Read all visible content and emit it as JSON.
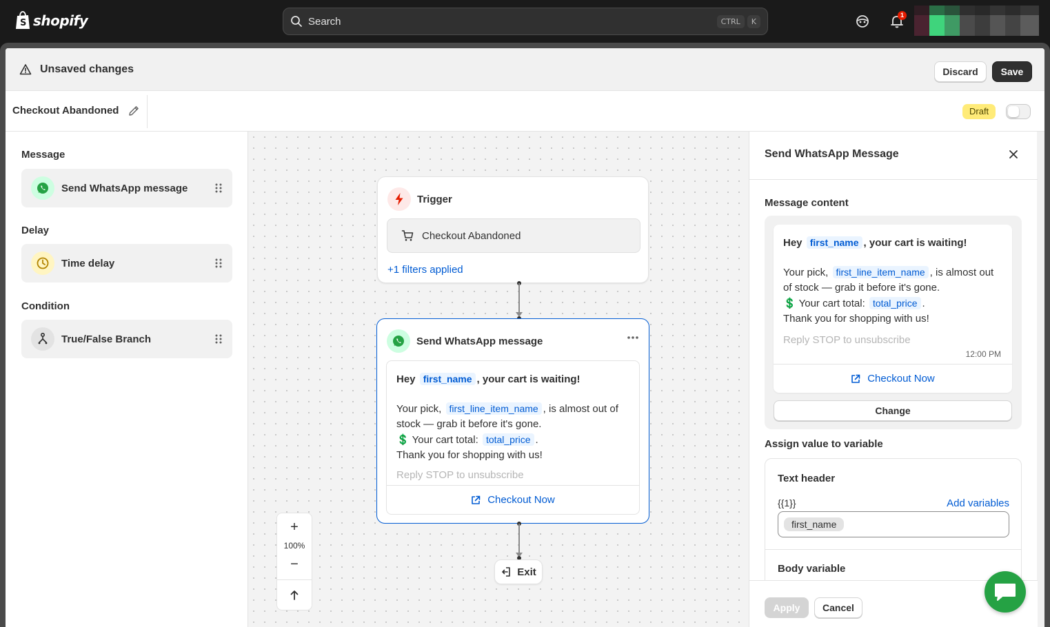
{
  "topbar": {
    "brand": "shopify",
    "search_placeholder": "Search",
    "shortcut_keys": [
      "CTRL",
      "K"
    ],
    "notification_count": "1"
  },
  "unsaved": {
    "message": "Unsaved changes",
    "discard_label": "Discard",
    "save_label": "Save"
  },
  "workflow": {
    "title": "Checkout Abandoned",
    "status": "Draft",
    "active": false
  },
  "palette": {
    "groups": [
      {
        "heading": "Message",
        "item": "Send WhatsApp message",
        "icon": "whatsapp-icon"
      },
      {
        "heading": "Delay",
        "item": "Time delay",
        "icon": "clock-icon"
      },
      {
        "heading": "Condition",
        "item": "True/False Branch",
        "icon": "branch-icon"
      }
    ]
  },
  "canvas": {
    "trigger": {
      "title": "Trigger",
      "event": "Checkout Abandoned",
      "filters_link": "+1 filters applied"
    },
    "message_node": {
      "title": "Send WhatsApp message",
      "greeting_prefix": "Hey",
      "greeting_var": "first_name",
      "greeting_suffix": ", your cart is waiting!",
      "line1_prefix": "Your pick,",
      "line1_var": "first_line_item_name",
      "line1_suffix": ", is almost out of stock — grab it before it's gone.",
      "total_emoji": "💲",
      "total_prefix": "Your cart total:",
      "total_var": "total_price",
      "total_suffix": ".",
      "thanks": "Thank you for shopping with us!",
      "footer": "Reply STOP to unsubscribe",
      "cta_label": "Checkout Now"
    },
    "exit_label": "Exit",
    "zoom_level": "100%",
    "zoom_in": "+",
    "zoom_out": "−"
  },
  "panel": {
    "title": "Send WhatsApp Message",
    "message_content_label": "Message content",
    "preview_time": "12:00 PM",
    "change_label": "Change",
    "assign_label": "Assign value to variable",
    "text_header_label": "Text header",
    "placeholder_token": "{{1}}",
    "add_variables_label": "Add variables",
    "header_value": "first_name",
    "body_variable_label": "Body variable",
    "apply_label": "Apply",
    "cancel_label": "Cancel"
  },
  "colors": {
    "accent": "#005bd3",
    "whatsapp": "#25a244",
    "draft_badge": "#ffeb78",
    "trigger_red": "#e51c00"
  }
}
